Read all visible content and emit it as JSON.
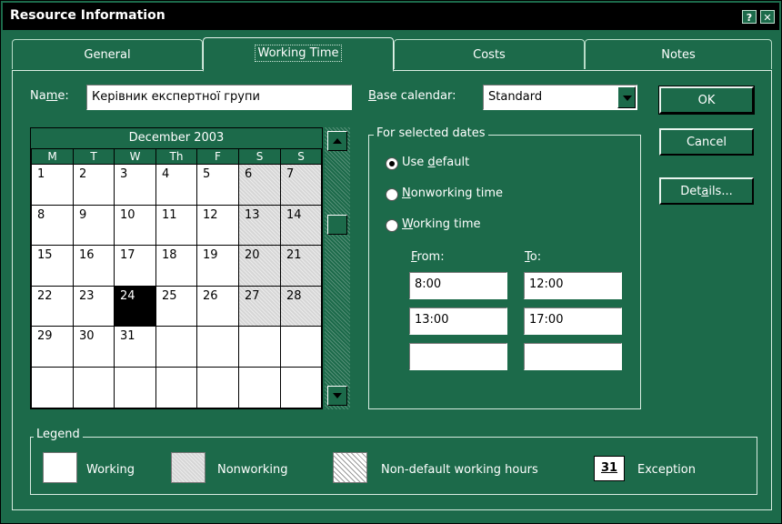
{
  "window": {
    "title": "Resource Information",
    "help_glyph": "?",
    "close_glyph": "✕"
  },
  "tabs": [
    {
      "label": "General"
    },
    {
      "label": "Working Time"
    },
    {
      "label": "Costs"
    },
    {
      "label": "Notes"
    }
  ],
  "name": {
    "label_pre": "Na",
    "label_ul": "m",
    "label_post": "e:",
    "value": "Керівник експертної групи"
  },
  "base_calendar": {
    "label_ul": "B",
    "label_post": "ase calendar:",
    "value": "Standard"
  },
  "buttons": {
    "ok": "OK",
    "cancel": "Cancel",
    "details_pre": "Det",
    "details_ul": "a",
    "details_post": "ils..."
  },
  "calendar": {
    "month": "December 2003",
    "day_headers": [
      "M",
      "T",
      "W",
      "Th",
      "F",
      "S",
      "S"
    ],
    "weeks": [
      [
        "1",
        "2",
        "3",
        "4",
        "5",
        "6",
        "7"
      ],
      [
        "8",
        "9",
        "10",
        "11",
        "12",
        "13",
        "14"
      ],
      [
        "15",
        "16",
        "17",
        "18",
        "19",
        "20",
        "21"
      ],
      [
        "22",
        "23",
        "24",
        "25",
        "26",
        "27",
        "28"
      ],
      [
        "29",
        "30",
        "31",
        "",
        "",
        "",
        ""
      ],
      [
        "",
        "",
        "",
        "",
        "",
        "",
        ""
      ]
    ],
    "selected_day": "24"
  },
  "selected_dates": {
    "title": "For selected dates",
    "use_default": {
      "pre": "Use ",
      "ul": "d",
      "post": "efault",
      "checked": true
    },
    "nonworking": {
      "pre": "",
      "ul": "N",
      "post": "onworking time",
      "checked": false
    },
    "working": {
      "pre": "",
      "ul": "W",
      "post": "orking time",
      "checked": false
    },
    "from_label": {
      "ul": "F",
      "post": "rom:"
    },
    "to_label": {
      "ul": "T",
      "post": "o:"
    },
    "from_values": [
      "8:00",
      "13:00",
      ""
    ],
    "to_values": [
      "12:00",
      "17:00",
      ""
    ]
  },
  "legend": {
    "title": "Legend",
    "items": {
      "working": "Working",
      "nonworking": "Nonworking",
      "nondefault": "Non-default working hours",
      "exception": "Exception"
    },
    "exception_sample": "31"
  },
  "colors": {
    "window_bg": "#1c6a4a",
    "title_bar": "#000000",
    "nonworking_cell": "#d6d6d6"
  }
}
